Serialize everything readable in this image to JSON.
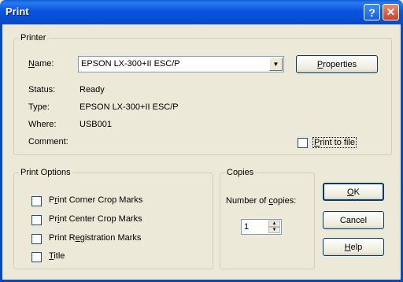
{
  "window": {
    "title": "Print",
    "help_glyph": "?",
    "close_glyph": "✕"
  },
  "printer": {
    "group_label": "Printer",
    "name_label": "Name:",
    "name_value": "EPSON LX-300+II ESC/P",
    "properties_label": "Properties",
    "status_label": "Status:",
    "status_value": "Ready",
    "type_label": "Type:",
    "type_value": "EPSON LX-300+II ESC/P",
    "where_label": "Where:",
    "where_value": "USB001",
    "comment_label": "Comment:",
    "print_to_file_label": "Print to file"
  },
  "print_options": {
    "group_label": "Print Options",
    "items": [
      {
        "label": "Print Corner Crop Marks",
        "checked": false
      },
      {
        "label": "Print Center Crop Marks",
        "checked": false
      },
      {
        "label": "Print Registration Marks",
        "checked": false
      },
      {
        "label": "Title",
        "checked": false
      }
    ]
  },
  "copies": {
    "group_label": "Copies",
    "number_label": "Number of copies:",
    "value": "1"
  },
  "buttons": {
    "ok": "OK",
    "cancel": "Cancel",
    "help": "Help"
  },
  "icons": {
    "dropdown": "chevron-down-icon",
    "spin_up": "spin-up-icon",
    "spin_down": "spin-down-icon"
  },
  "colors": {
    "titlebar": "#0855dd",
    "dialog_bg": "#ece9d8",
    "close_button": "#c9422a"
  }
}
